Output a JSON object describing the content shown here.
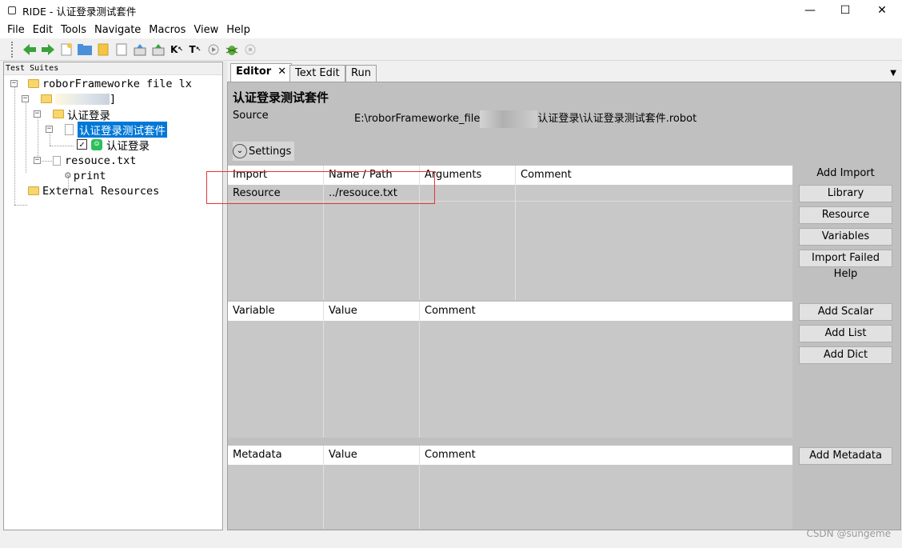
{
  "window": {
    "title": "RIDE - 认证登录测试套件",
    "controls": {
      "minimize": "—",
      "maximize": "☐",
      "close": "✕"
    }
  },
  "menu": [
    "File",
    "Edit",
    "Tools",
    "Navigate",
    "Macros",
    "View",
    "Help"
  ],
  "toolbar": {
    "icons": [
      "back-arrow-icon",
      "forward-arrow-icon",
      "new-project-icon",
      "open-folder-icon",
      "open-directory-icon",
      "new-file-icon",
      "save-icon",
      "save-all-icon",
      "search-keywords-icon",
      "search-tests-icon",
      "run-icon",
      "debug-bug-icon",
      "stop-icon"
    ],
    "k_label": "K",
    "t_label": "T"
  },
  "left": {
    "header": "Test Suites",
    "tree": {
      "root": "roborFrameworke file lx",
      "blurred_suffix": "]",
      "folder": "认证登录",
      "suite": "认证登录测试套件",
      "test": "认证登录",
      "resource": "resouce.txt",
      "keyword": "print",
      "external": "External Resources"
    }
  },
  "tabs": [
    {
      "label": "Editor",
      "close": "✕"
    },
    {
      "label": "Text Edit"
    },
    {
      "label": "Run"
    }
  ],
  "editor": {
    "title": "认证登录测试套件",
    "source_label": "Source",
    "source_prefix": "E:\\roborFrameworke_file",
    "source_suffix": "认证登录\\认证登录测试套件.robot",
    "settings_label": "Settings",
    "import_table": {
      "columns": [
        "Import",
        "Name / Path",
        "Arguments",
        "Comment"
      ],
      "rows": [
        [
          "Resource",
          "../resouce.txt",
          "",
          ""
        ]
      ]
    },
    "variable_table": {
      "columns": [
        "Variable",
        "Value",
        "Comment"
      ]
    },
    "metadata_table": {
      "columns": [
        "Metadata",
        "Value",
        "Comment"
      ]
    },
    "import_buttons": {
      "header": "Add Import",
      "library": "Library",
      "resource": "Resource",
      "variables": "Variables",
      "failed_help": "Import Failed Help"
    },
    "variable_buttons": {
      "scalar": "Add Scalar",
      "list": "Add List",
      "dict": "Add Dict"
    },
    "metadata_buttons": {
      "add": "Add Metadata"
    }
  },
  "watermark": "CSDN @sungeme"
}
